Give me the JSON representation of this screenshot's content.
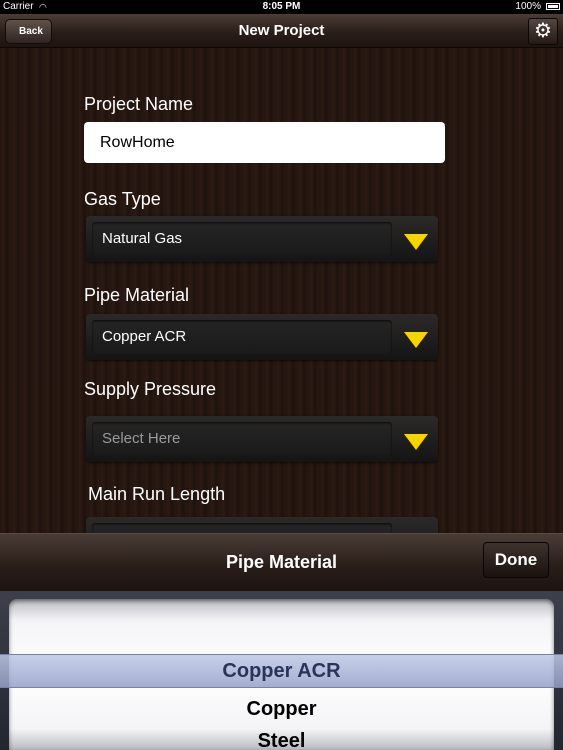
{
  "status_bar": {
    "carrier": "Carrier",
    "time": "8:05 PM",
    "battery": "100%"
  },
  "nav": {
    "back_label": "Back",
    "title": "New Project",
    "settings_icon": "gear-icon"
  },
  "form": {
    "project_name": {
      "label": "Project Name",
      "value": "RowHome"
    },
    "gas_type": {
      "label": "Gas Type",
      "value": "Natural Gas"
    },
    "pipe_material": {
      "label": "Pipe Material",
      "value": "Copper ACR"
    },
    "supply_pressure": {
      "label": "Supply Pressure",
      "placeholder": "Select Here"
    },
    "main_run_length": {
      "label": "Main Run Length"
    }
  },
  "picker": {
    "title": "Pipe Material",
    "done_label": "Done",
    "options": [
      "Copper ACR",
      "Copper",
      "Steel"
    ],
    "selected": "Copper ACR"
  },
  "colors": {
    "accent_arrow": "#f5d400",
    "selection": "#283459"
  }
}
